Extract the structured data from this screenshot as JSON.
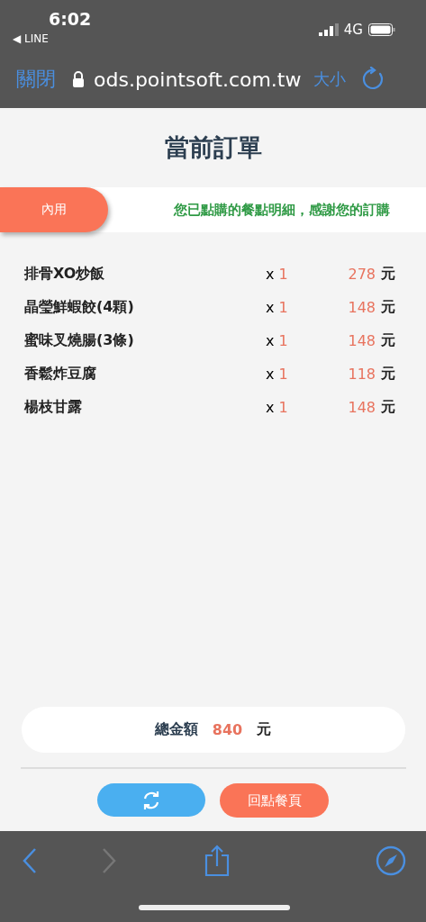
{
  "status_bar": {
    "time": "6:02",
    "back_app": "◀ LINE",
    "network": "4G"
  },
  "browser_bar": {
    "close": "關閉",
    "url": "ods.pointsoft.com.tw",
    "text_size": "大小"
  },
  "page": {
    "title": "當前訂單",
    "tabs": [
      {
        "label": "內用",
        "selected": true
      }
    ],
    "message": "您已點購的餐點明細，感謝您的訂購",
    "items": [
      {
        "name": "排骨XO炒飯",
        "qty_prefix": "x",
        "qty": "1",
        "price": "278",
        "unit": "元"
      },
      {
        "name": "晶瑩鮮蝦餃(4顆)",
        "qty_prefix": "x",
        "qty": "1",
        "price": "148",
        "unit": "元"
      },
      {
        "name": "蜜味叉燒腸(3條)",
        "qty_prefix": "x",
        "qty": "1",
        "price": "148",
        "unit": "元"
      },
      {
        "name": "香鬆炸豆腐",
        "qty_prefix": "x",
        "qty": "1",
        "price": "118",
        "unit": "元"
      },
      {
        "name": "楊枝甘露",
        "qty_prefix": "x",
        "qty": "1",
        "price": "148",
        "unit": "元"
      }
    ],
    "total": {
      "label": "總金額",
      "amount": "840",
      "unit": "元"
    },
    "back_button": "回點餐頁"
  },
  "toolbar": {
    "back_disabled": false,
    "forward_disabled": true
  }
}
